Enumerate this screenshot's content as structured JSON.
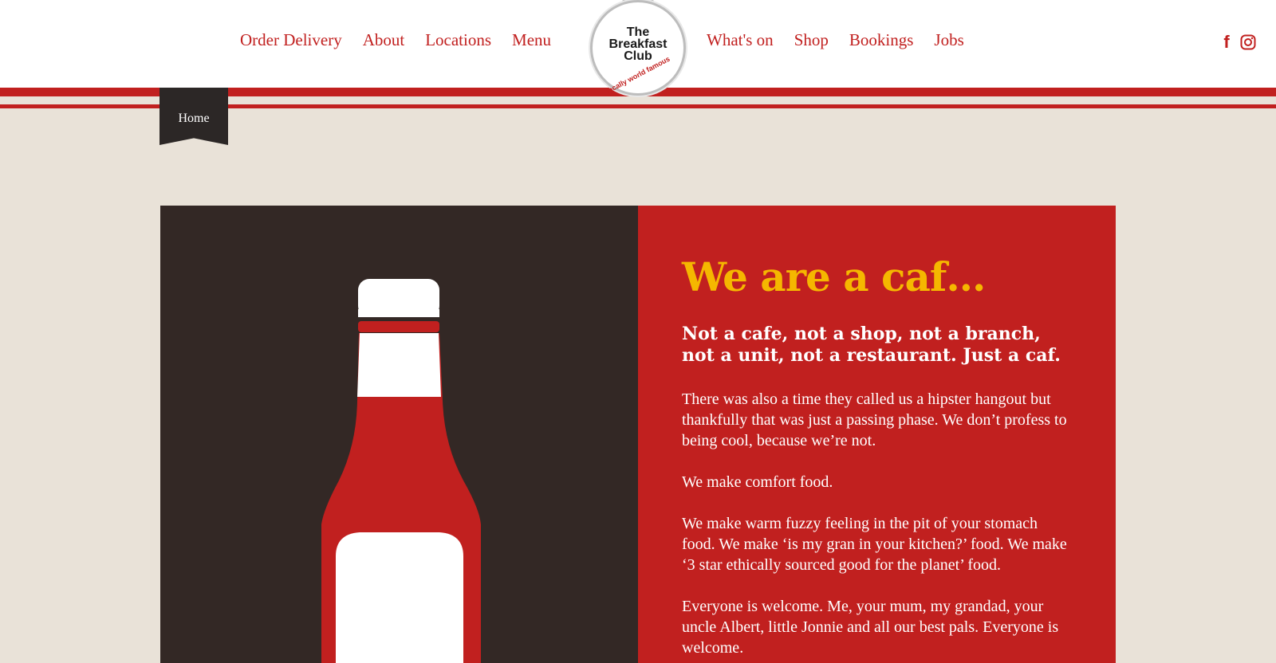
{
  "nav_left": [
    "Order Delivery",
    "About",
    "Locations",
    "Menu"
  ],
  "nav_right": [
    "What's on",
    "Shop",
    "Bookings",
    "Jobs"
  ],
  "logo": {
    "line1": "The",
    "line2": "Breakfast",
    "line3": "Club",
    "tagline": "locally world famous"
  },
  "social": {
    "facebook": "f",
    "icons": [
      "facebook-icon",
      "instagram-icon"
    ]
  },
  "breadcrumb": {
    "label": "Home"
  },
  "hero": {
    "headline": "We are a caf…",
    "subhead": "Not a cafe, not a shop, not a branch, not a unit, not a restaurant. Just a caf.",
    "paragraphs": [
      "There was also a time they called us a hipster hangout but thankfully that was just a passing phase. We don’t profess to being cool, because we’re not.",
      "We make comfort food.",
      "We make warm fuzzy feeling in the pit of your stomach food. We make ‘is my gran in your kitchen?’ food. We make ‘3 star ethically sourced good for the planet’ food.",
      "Everyone is welcome. Me, your mum, my grandad, your uncle Albert, little Jonnie and all our best pals. Everyone is welcome."
    ]
  },
  "colors": {
    "brand_red": "#c1201f",
    "accent_yellow": "#f5b700",
    "dark_panel": "#332825",
    "background": "#e9e2d8"
  }
}
